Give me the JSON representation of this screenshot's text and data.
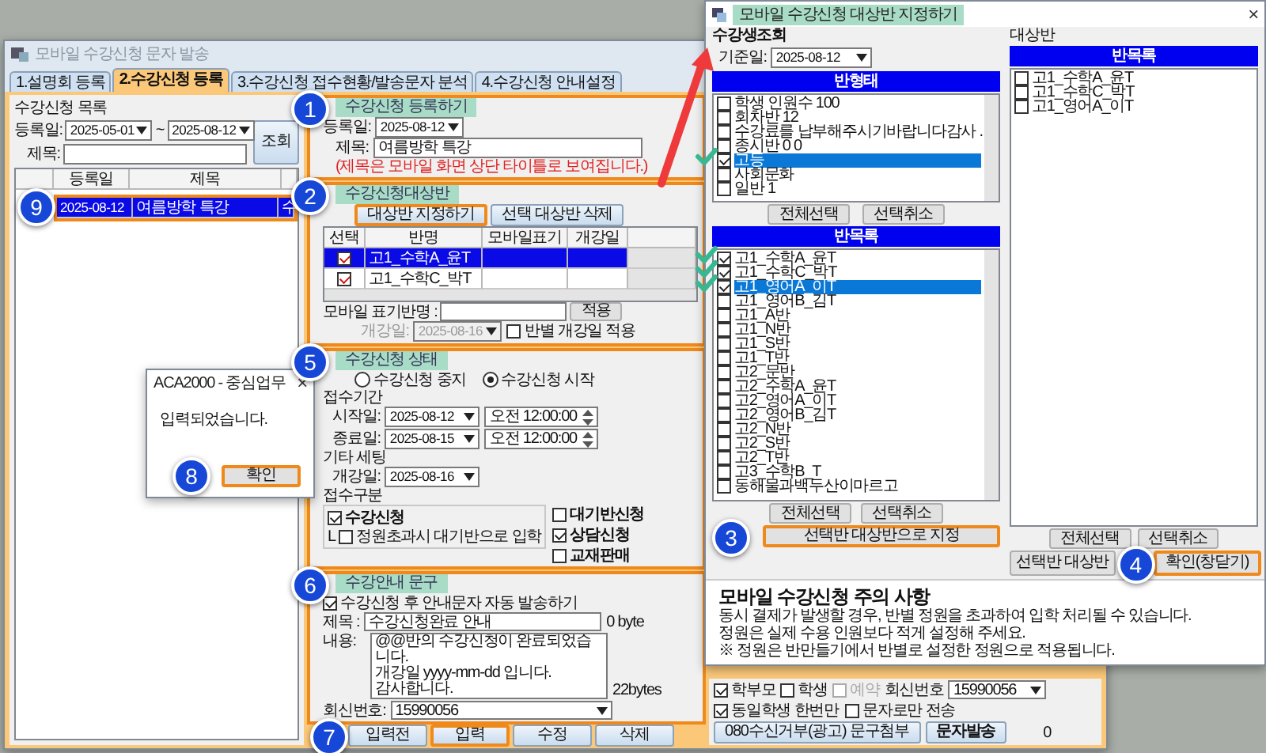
{
  "main_window": {
    "title": "모바일 수강신청  문자 발송",
    "tabs": [
      {
        "label": "1.설명회 등록",
        "selected": false
      },
      {
        "label": "2.수강신청 등록",
        "selected": true
      },
      {
        "label": "3.수강신청 접수현황/발송문자 분석",
        "selected": false
      },
      {
        "label": "4.수강신청 안내설정",
        "selected": false
      }
    ],
    "list_panel": {
      "title": "수강신청 목록",
      "date_label": "등록일:",
      "date_from": "2025-05-01",
      "tilde": "~",
      "date_to": "2025-08-12",
      "search_button": "조회",
      "title_label": "제목:",
      "columns": [
        "등록일",
        "제목"
      ],
      "rows": [
        {
          "date": "2025-08-12",
          "title": "여름방학 특강",
          "extra": "수",
          "selected": true,
          "highlighted": true
        }
      ]
    },
    "register": {
      "header": "수강신청 등록하기",
      "date_label": "등록일:",
      "date": "2025-08-12",
      "title_label": "제목:",
      "title": "여름방학 특강",
      "note": "(제목은 모바일 화면 상단 타이틀로 보여집니다.)",
      "highlighted": true
    },
    "targets": {
      "header": "수강신청대상반",
      "highlighted": true,
      "buttons": [
        {
          "label": "대상반 지정하기",
          "highlighted": true
        },
        {
          "label": "선택 대상반 삭제",
          "highlighted": false
        }
      ],
      "columns": [
        "선택",
        "반명",
        "모바일표기",
        "개강일"
      ],
      "rows": [
        {
          "checked": true,
          "name": "고1_수학A_윤T",
          "selected": true
        },
        {
          "checked": true,
          "name": "고1_수학C_박T",
          "selected": false
        }
      ],
      "mobile_label": "모바일 표기반명 :",
      "apply_button": "적용",
      "start_label": "개강일:",
      "start_date": "2025-08-16",
      "start_disabled": true,
      "per_class_label": "반별 개강일 적용",
      "per_class_checked": false
    },
    "status": {
      "header": "수강신청 상태",
      "highlighted": true,
      "radios": [
        {
          "label": "수강신청 중지",
          "selected": false
        },
        {
          "label": "수강신청 시작",
          "selected": true
        }
      ],
      "period_label": "접수기간",
      "start_label": "시작일:",
      "start_date": "2025-08-12",
      "start_time": "오전 12:00:00",
      "end_label": "종료일:",
      "end_date": "2025-08-15",
      "end_time": "오전 12:00:00",
      "etc_label": "기타 세팅",
      "open_label": "개강일:",
      "open_date": "2025-08-16",
      "type_label": "접수구분",
      "sub_mark": "L",
      "options": [
        {
          "label": "수강신청",
          "checked": true
        },
        {
          "label": "정원초과시 대기반으로 입학",
          "checked": false
        },
        {
          "label": "대기반신청",
          "checked": false
        },
        {
          "label": "상담신청",
          "checked": true
        },
        {
          "label": "교재판매",
          "checked": false
        }
      ]
    },
    "notice_text": {
      "header": "수강안내 문구",
      "highlighted": true,
      "auto_label": "수강신청  후 안내문자 자동 발송하기",
      "auto_checked": true,
      "title_label": "제목 :",
      "title": "수강신청완료 안내",
      "title_bytes": "0 byte",
      "body_label": "내용:",
      "body": "@@반의 수강신청이 완료되었습니다.\n개강일 yyyy-mm-dd 입니다.\n감사합니다.",
      "body_bytes": "22bytes",
      "reply_label": "회신번호:",
      "reply": "15990056"
    },
    "actions": [
      {
        "label": "입력전",
        "highlighted": false
      },
      {
        "label": "입력",
        "highlighted": true
      },
      {
        "label": "수정",
        "highlighted": false
      },
      {
        "label": "삭제",
        "highlighted": false
      }
    ],
    "send_panel": {
      "recipients": [
        {
          "label": "학부모",
          "checked": true,
          "disabled": false
        },
        {
          "label": "학생",
          "checked": false,
          "disabled": false
        },
        {
          "label": "예약",
          "checked": false,
          "disabled": true
        }
      ],
      "reply_label": "회신번호",
      "reply": "15990056",
      "once_label": "동일학생 한번만",
      "once_checked": true,
      "sms_only_label": "문자로만 전송",
      "sms_only_checked": false,
      "optout_button": "080수신거부(광고) 문구첨부",
      "send_button": "문자발송",
      "count": "0"
    }
  },
  "target_window": {
    "title": "모바일 수강신청 대상반 지정하기",
    "close": "×",
    "lookup_label": "수강생조회",
    "base_date_label": "기준일:",
    "base_date": "2025-08-12",
    "type_header": "반형태",
    "types": [
      {
        "label": "학생 인원수 100",
        "checked": false,
        "selected": false
      },
      {
        "label": "회차반 12",
        "checked": false,
        "selected": false
      },
      {
        "label": "수강료를 납부해주시기바랍니다감사 .",
        "checked": false,
        "selected": false
      },
      {
        "label": "종시반 0 0",
        "checked": false,
        "selected": false
      },
      {
        "label": "고등",
        "checked": true,
        "selected": true
      },
      {
        "label": "사회문화",
        "checked": false,
        "selected": false
      },
      {
        "label": "일반 1",
        "checked": false,
        "selected": false
      }
    ],
    "type_buttons": [
      "전체선택",
      "선택취소"
    ],
    "class_header": "반목록",
    "classes": [
      {
        "label": "고1_수학A_윤T",
        "checked": true,
        "selected": false
      },
      {
        "label": "고1_수학C_박T",
        "checked": true,
        "selected": false
      },
      {
        "label": "고1_영어A_이T",
        "checked": true,
        "selected": true
      },
      {
        "label": "고1_영어B_김T",
        "checked": false,
        "selected": false
      },
      {
        "label": "고1_A반",
        "checked": false,
        "selected": false
      },
      {
        "label": "고1_N반",
        "checked": false,
        "selected": false
      },
      {
        "label": "고1_S반",
        "checked": false,
        "selected": false
      },
      {
        "label": "고1_T반",
        "checked": false,
        "selected": false
      },
      {
        "label": "고2_문반",
        "checked": false,
        "selected": false
      },
      {
        "label": "고2_수학A_윤T",
        "checked": false,
        "selected": false
      },
      {
        "label": "고2_영어A_이T",
        "checked": false,
        "selected": false
      },
      {
        "label": "고2_영어B_김T",
        "checked": false,
        "selected": false
      },
      {
        "label": "고2_N반",
        "checked": false,
        "selected": false
      },
      {
        "label": "고2_S반",
        "checked": false,
        "selected": false
      },
      {
        "label": "고2_T반",
        "checked": false,
        "selected": false
      },
      {
        "label": "고3_수학B_T",
        "checked": false,
        "selected": false
      },
      {
        "label": "동해물과백두산이마르고",
        "checked": false,
        "selected": false
      }
    ],
    "class_buttons": [
      "전체선택",
      "선택취소"
    ],
    "assign_button": {
      "label": "선택반 대상반으로 지정",
      "highlighted": true
    },
    "target_label": "대상반",
    "target_header": "반목록",
    "targets": [
      {
        "label": "고1_수학A_윤T",
        "checked": false
      },
      {
        "label": "고1_수학C_박T",
        "checked": false
      },
      {
        "label": "고1_영어A_이T",
        "checked": false
      }
    ],
    "target_buttons": [
      "전체선택",
      "선택취소"
    ],
    "assign_short": "선택반 대상반",
    "close_button": {
      "label": "확인(창닫기)",
      "highlighted": true
    }
  },
  "caution": {
    "title": "모바일 수강신청 주의 사항",
    "lines": [
      "동시 결제가 발생할 경우, 반별 정원을 초과하여 입학 처리될 수 있습니다.",
      "정원은 실제 수용 인원보다 적게 설정해 주세요.",
      "※ 정원은 반만들기에서 반별로 설정한 정원으로 적용됩니다."
    ]
  },
  "dialog": {
    "title": "ACA2000 - 중심업무",
    "close": "×",
    "message": "입력되었습니다.",
    "button": {
      "label": "확인",
      "highlighted": true
    }
  },
  "badges": [
    "1",
    "2",
    "3",
    "4",
    "5",
    "6",
    "7",
    "8",
    "9"
  ]
}
